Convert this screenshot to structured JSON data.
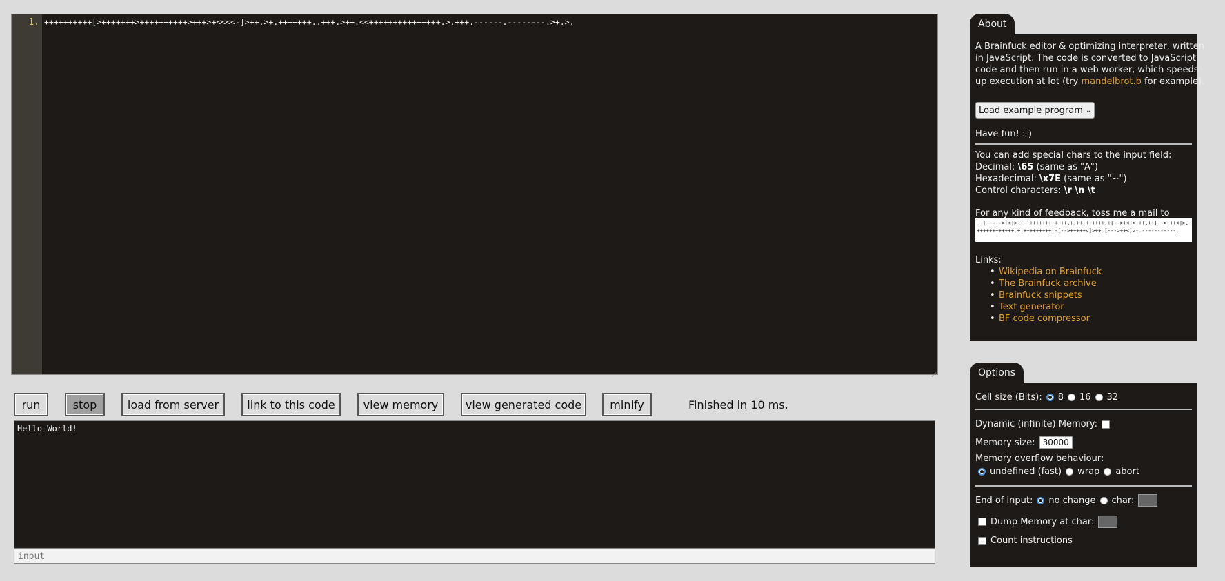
{
  "editor": {
    "line_number": "1.",
    "code": "++++++++++[>+++++++>++++++++++>+++>+<<<<-]>++.>+.+++++++..+++.>++.<<+++++++++++++++.>.+++.------.--------.>+.>."
  },
  "toolbar": {
    "run": "run",
    "stop": "stop",
    "load_from_server": "load from server",
    "link_to_code": "link to this code",
    "view_memory": "view memory",
    "view_generated_code": "view generated code",
    "minify": "minify",
    "status": "Finished in 10 ms."
  },
  "output": {
    "text": "Hello World!"
  },
  "input": {
    "placeholder": "input"
  },
  "about": {
    "tab": "About",
    "intro_1": "A Brainfuck editor & optimizing interpreter, written",
    "intro_2": "in JavaScript. The code is converted to JavaScript",
    "intro_3": "code and then run in a web worker, which speeds",
    "intro_4a": "up execution at lot (try ",
    "intro_link": "mandelbrot.b",
    "intro_4b": " for example).",
    "select_label": "Load example program",
    "have_fun": "Have fun! :-)",
    "special_chars": "You can add special chars to the input field:",
    "decimal_label": "Decimal: ",
    "decimal_code": "\\65",
    "decimal_note": " (same as \"A\")",
    "hex_label": "Hexadecimal: ",
    "hex_code": "\\x7E",
    "hex_note": " (same as \"~\")",
    "control_label": "Control characters: ",
    "control_code": "\\r \\n \\t",
    "feedback": "For any kind of feedback, toss me a mail to",
    "mail_code": "--[----->+<]>---.++++++++++++.+.+++++++++.+[-->+<]>+++.++[-->+++<]>.++++++++++++.+.+++++++++.-[-->+++++<]>++.[--->++<]>-.-----------.",
    "links_label": "Links:",
    "links": [
      "Wikipedia on Brainfuck",
      "The Brainfuck archive",
      "Brainfuck snippets",
      "Text generator",
      "BF code compressor"
    ]
  },
  "options": {
    "tab": "Options",
    "cell_size_label": "Cell size (Bits):",
    "cell_8": "8",
    "cell_16": "16",
    "cell_32": "32",
    "dynamic_memory": "Dynamic (infinite) Memory:",
    "memory_size_label": "Memory size:",
    "memory_size_value": "30000",
    "overflow_label": "Memory overflow behaviour:",
    "overflow_undefined": "undefined (fast)",
    "overflow_wrap": "wrap",
    "overflow_abort": "abort",
    "end_of_input_label": "End of input:",
    "eoi_no_change": "no change",
    "eoi_char": "char:",
    "dump_memory": "Dump Memory at char:",
    "count_instructions": "Count instructions"
  },
  "colors": {
    "link": "#e0a030",
    "panel_bg": "#1e1a17",
    "page_bg": "#dcdcdc",
    "radio_selected": "#4a90d9"
  }
}
